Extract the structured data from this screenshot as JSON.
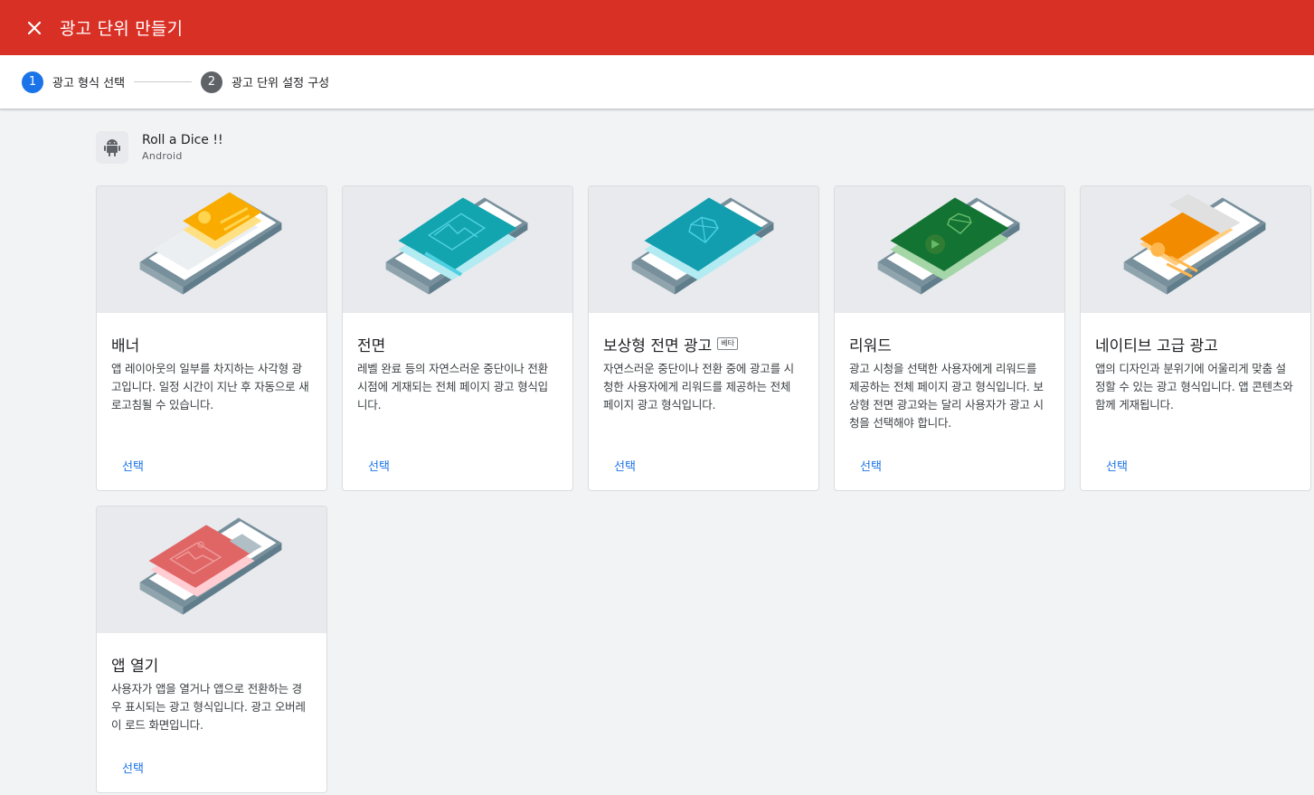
{
  "header": {
    "title": "광고 단위 만들기"
  },
  "stepper": {
    "steps": [
      {
        "number": "1",
        "label": "광고 형식 선택"
      },
      {
        "number": "2",
        "label": "광고 단위 설정 구성"
      }
    ]
  },
  "app": {
    "name": "Roll a Dice !!",
    "platform": "Android"
  },
  "formats": [
    {
      "title": "배너",
      "description": "앱 레이아웃의 일부를 차지하는 사각형 광고입니다. 일정 시간이 지난 후 자동으로 새로고침될 수 있습니다.",
      "action": "선택"
    },
    {
      "title": "전면",
      "description": "레벨 완료 등의 자연스러운 중단이나 전환 시점에 게재되는 전체 페이지 광고 형식입니다.",
      "action": "선택"
    },
    {
      "title": "보상형 전면 광고",
      "badge": "베타",
      "description": "자연스러운 중단이나 전환 중에 광고를 시청한 사용자에게 리워드를 제공하는 전체 페이지 광고 형식입니다.",
      "action": "선택"
    },
    {
      "title": "리워드",
      "description": "광고 시청을 선택한 사용자에게 리워드를 제공하는 전체 페이지 광고 형식입니다. 보상형 전면 광고와는 달리 사용자가 광고 시청을 선택해야 합니다.",
      "action": "선택"
    },
    {
      "title": "네이티브 고급 광고",
      "description": "앱의 디자인과 분위기에 어울리게 맞춤 설정할 수 있는 광고 형식입니다. 앱 콘텐츠와 함께 게재됩니다.",
      "action": "선택"
    },
    {
      "title": "앱 열기",
      "description": "사용자가 앱을 열거나 앱으로 전환하는 경우 표시되는 광고 형식입니다. 광고 오버레이 로드 화면입니다.",
      "action": "선택"
    }
  ],
  "colors": {
    "header_bg": "#d93025",
    "active_step": "#1a73e8",
    "banner": "#f9ab00",
    "interstitial": "#12a4af",
    "rewarded_interstitial": "#129eaf",
    "rewarded": "#137333",
    "native": "#f28b00",
    "app_open": "#e06666"
  }
}
